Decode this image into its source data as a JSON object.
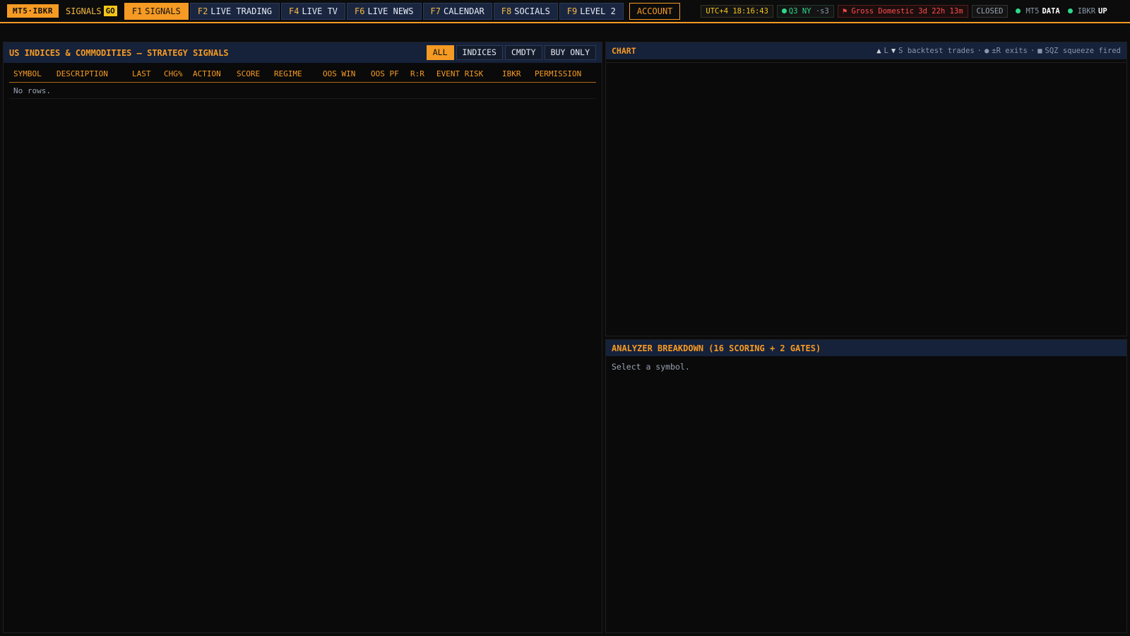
{
  "topbar": {
    "brand": "MT5·IBKR",
    "signals_label": "SIGNALS",
    "signals_badge": "GO",
    "tabs": [
      {
        "key": "F1",
        "label": "SIGNALS",
        "active": true
      },
      {
        "key": "F2",
        "label": "LIVE TRADING"
      },
      {
        "key": "F4",
        "label": "LIVE TV"
      },
      {
        "key": "F6",
        "label": "LIVE NEWS"
      },
      {
        "key": "F7",
        "label": "CALENDAR"
      },
      {
        "key": "F8",
        "label": "SOCIALS"
      },
      {
        "key": "F9",
        "label": "LEVEL 2"
      }
    ],
    "account_label": "ACCOUNT",
    "clock": "UTC+4 18:16:43",
    "session_main": "Q3 NY",
    "session_sub": "·s3",
    "event": "Gross Domestic 3d 22h 13m",
    "market_status": "CLOSED",
    "conn_mt5_label": "MT5",
    "conn_mt5_value": "DATA",
    "conn_ibkr_label": "IBKR",
    "conn_ibkr_value": "UP"
  },
  "signals_panel": {
    "title": "US INDICES & COMMODITIES — STRATEGY SIGNALS",
    "filters": [
      "ALL",
      "INDICES",
      "CMDTY",
      "BUY ONLY"
    ],
    "columns": [
      "SYMBOL",
      "DESCRIPTION",
      "LAST",
      "CHG%",
      "ACTION",
      "SCORE",
      "REGIME",
      "OOS WIN",
      "OOS PF",
      "R:R",
      "EVENT RISK",
      "IBKR",
      "PERMISSION"
    ],
    "empty_text": "No rows."
  },
  "chart_panel": {
    "title": "CHART",
    "legend_long": "L",
    "legend_short": "S backtest trades",
    "legend_exits": "±R exits",
    "legend_sqz": "SQZ squeeze fired",
    "separator": "·"
  },
  "analyzer_panel": {
    "title": "ANALYZER BREAKDOWN (16 SCORING + 2 GATES)",
    "empty_text": "Select a symbol."
  },
  "colors": {
    "accent": "#f59a23",
    "header_bg": "#16213a",
    "positive": "#2fd98a",
    "negative": "#ff4d4d"
  }
}
